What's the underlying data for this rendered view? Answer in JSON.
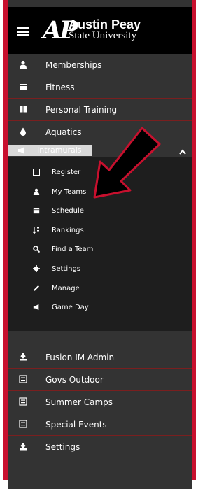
{
  "brand": {
    "logo_mark": "AP",
    "name": "Austin Peay",
    "subtitle": "State University"
  },
  "menu": {
    "items": [
      {
        "label": "Memberships",
        "icon": "user-icon"
      },
      {
        "label": "Fitness",
        "icon": "calendar-icon"
      },
      {
        "label": "Personal Training",
        "icon": "book-icon"
      },
      {
        "label": "Aquatics",
        "icon": "droplet-icon"
      }
    ],
    "active": {
      "label": "Intramurals",
      "icon": "megaphone-icon"
    },
    "submenu": [
      {
        "label": "Register",
        "icon": "list-icon"
      },
      {
        "label": "My Teams",
        "icon": "user-icon"
      },
      {
        "label": "Schedule",
        "icon": "calendar-icon"
      },
      {
        "label": "Rankings",
        "icon": "sort-icon"
      },
      {
        "label": "Find a Team",
        "icon": "search-icon"
      },
      {
        "label": "Settings",
        "icon": "gear-icon"
      },
      {
        "label": "Manage",
        "icon": "pencil-icon"
      },
      {
        "label": "Game Day",
        "icon": "megaphone-icon"
      }
    ],
    "lower_items": [
      {
        "label": "Fusion IM Admin",
        "icon": "download-icon"
      },
      {
        "label": "Govs Outdoor",
        "icon": "list-icon"
      },
      {
        "label": "Summer Camps",
        "icon": "list-icon"
      },
      {
        "label": "Special Events",
        "icon": "list-icon"
      },
      {
        "label": "Settings",
        "icon": "download-icon"
      }
    ]
  },
  "colors": {
    "accent": "#c8102e",
    "sidebar_bg": "#333333",
    "submenu_bg": "#1e1e1e",
    "header_bg": "#000000",
    "annotation_arrow": "#000000"
  }
}
